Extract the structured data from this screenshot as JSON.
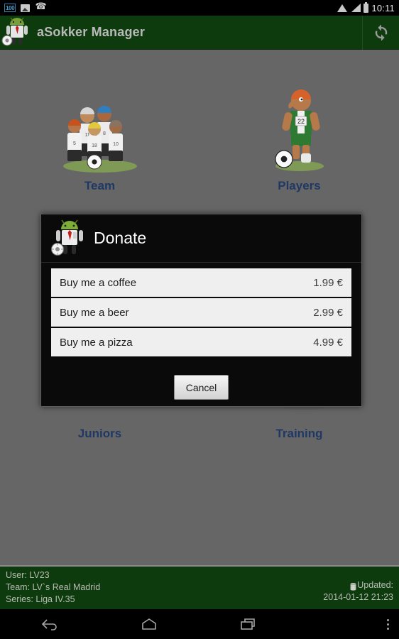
{
  "statusbar": {
    "battery_badge": "100",
    "icons": [
      "battery-100-badge",
      "image-icon",
      "phone-icon",
      "wifi-icon",
      "signal-icon",
      "battery-icon"
    ],
    "time": "10:11"
  },
  "appbar": {
    "title": "aSokker Manager",
    "logo_name": "android-manager-logo",
    "refresh_label": "refresh-icon",
    "background": "#0d3b0d"
  },
  "grid": {
    "items": [
      {
        "label": "Team",
        "art": "team-squad-illustration"
      },
      {
        "label": "Players",
        "art": "player-number-22-illustration"
      },
      {
        "label": "Juniors",
        "art": "junior-player-illustration"
      },
      {
        "label": "Training",
        "art": "coach-training-illustration"
      }
    ],
    "label_color": "#1f3864",
    "background": "#666666"
  },
  "dialog": {
    "title": "Donate",
    "icon_name": "android-manager-logo",
    "items": [
      {
        "label": "Buy me a coffee",
        "price": "1.99 €"
      },
      {
        "label": "Buy me a beer",
        "price": "2.99 €"
      },
      {
        "label": "Buy me a pizza",
        "price": "4.99 €"
      }
    ],
    "cancel_label": "Cancel"
  },
  "infobar": {
    "user": "User: LV23",
    "team": "Team: LV`s Real Madrid",
    "series": "Series: Liga IV.35",
    "updated_label": "Updated:",
    "updated_value": "2014-01-12 21:23",
    "background": "#0d3b0d"
  },
  "navbar": {
    "back": "back-icon",
    "home": "home-icon",
    "recents": "recents-icon",
    "overflow": "overflow-menu-icon"
  }
}
